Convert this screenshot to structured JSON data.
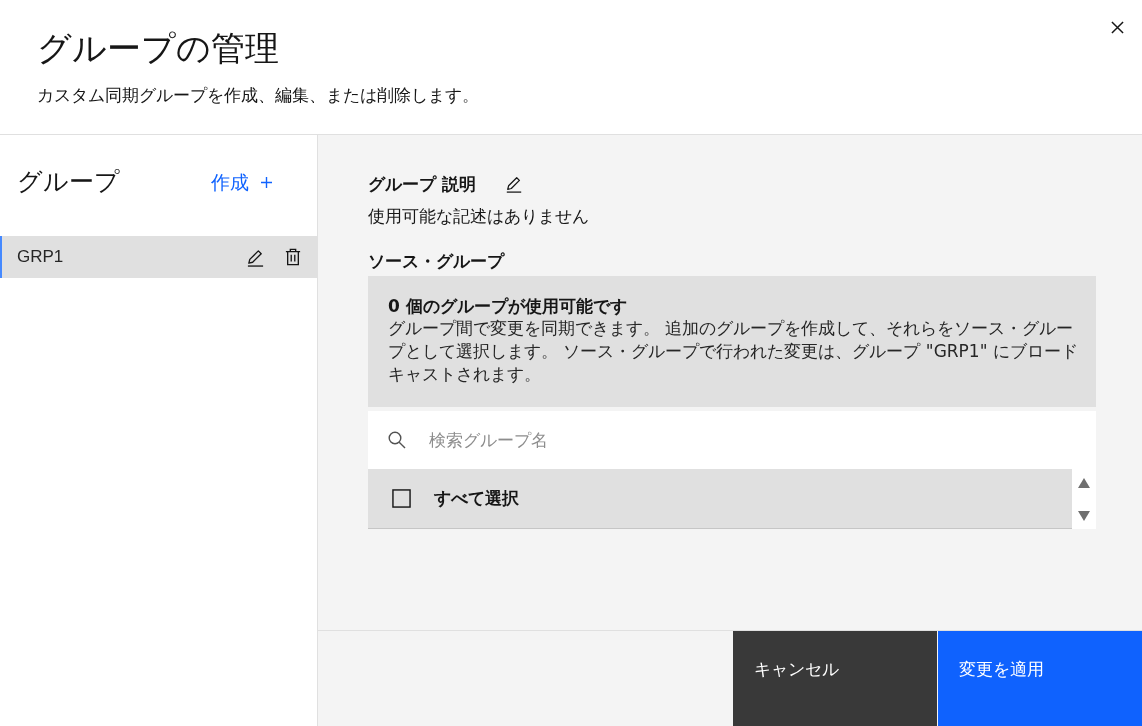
{
  "dialog": {
    "title": "グループの管理",
    "subtitle": "カスタム同期グループを作成、編集、または削除します。"
  },
  "sidebar": {
    "heading": "グループ",
    "create_link": "作成",
    "items": [
      {
        "name": "GRP1",
        "selected": true
      }
    ]
  },
  "detail": {
    "description_label": "グループ 説明",
    "description": "使用可能な記述はありません",
    "source_label": "ソース・グループ",
    "notice": {
      "title": "0 個のグループが使用可能です",
      "body": "グループ間で変更を同期できます。 追加のグループを作成して、それらをソース・グループとして選択します。 ソース・グループで行われた変更は、グループ \"GRP1\" にブロードキャストされます。"
    },
    "search": {
      "placeholder": "検索グループ名"
    },
    "select_all": {
      "label": "すべて選択",
      "checked": false
    }
  },
  "buttons": [
    {
      "label": "キャンセル",
      "kind": "secondary"
    },
    {
      "label": "変更を適用",
      "kind": "primary"
    }
  ]
}
